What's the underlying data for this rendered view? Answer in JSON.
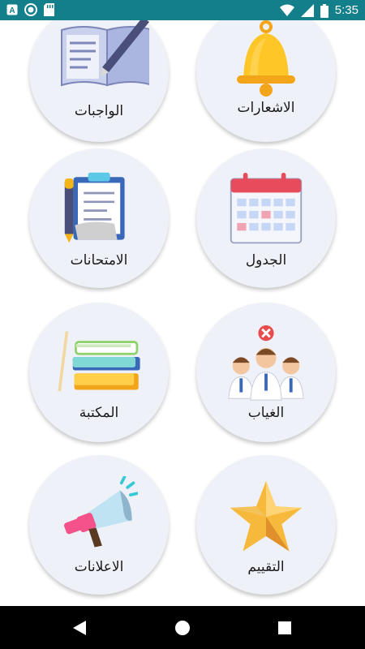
{
  "status_bar": {
    "time": "5:35",
    "icons": [
      "app-a-icon",
      "circle-icon",
      "sd-card-icon",
      "wifi-icon",
      "signal-icon",
      "battery-icon"
    ],
    "app_letter": "A",
    "background": "#137f8b"
  },
  "menu": {
    "tiles": [
      {
        "label": "الاشعارات",
        "icon": "bell-icon"
      },
      {
        "label": "الواجبات",
        "icon": "notebook-pen-icon"
      },
      {
        "label": "الجدول",
        "icon": "calendar-icon"
      },
      {
        "label": "الامتحانات",
        "icon": "exam-clipboard-icon"
      },
      {
        "label": "الغياب",
        "icon": "absence-students-icon"
      },
      {
        "label": "المكتبة",
        "icon": "books-icon"
      },
      {
        "label": "التقييم",
        "icon": "star-icon"
      },
      {
        "label": "الاعلانات",
        "icon": "megaphone-icon"
      }
    ],
    "tile_background": "#eef1f8"
  },
  "nav_bar": {
    "buttons": [
      "back-icon",
      "home-icon",
      "recents-icon"
    ]
  }
}
